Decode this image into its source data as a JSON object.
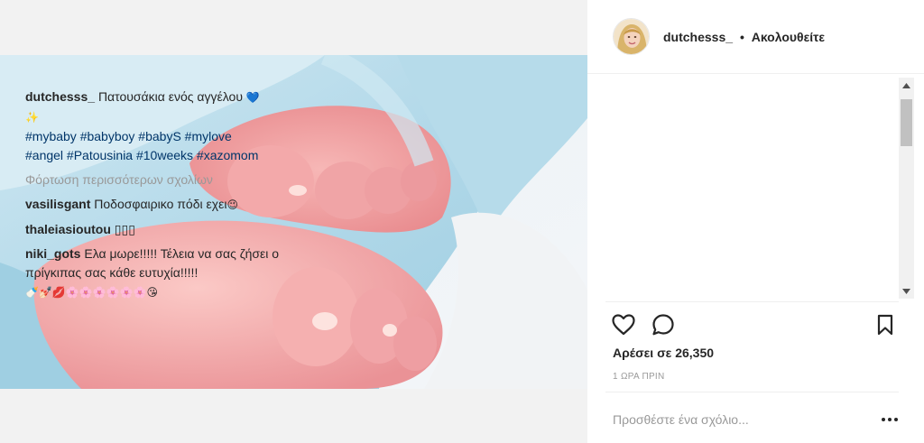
{
  "header": {
    "username": "dutchesss_",
    "separator": "•",
    "follow_status": "Ακολουθείτε"
  },
  "caption": {
    "username": "dutchesss_",
    "text": "Πατουσάκια ενός αγγέλου",
    "emoji_heart": "💙",
    "emoji_sparkles": "✨",
    "hashtags_line1": "#mybaby #babyboy #babyS #mylove",
    "hashtags_line2": "#angel #Patousinia #10weeks #xazomom"
  },
  "load_more": "Φόρτωση περισσότερων σχολίων",
  "comments": [
    {
      "username": "vasilisgant",
      "text": "Ποδοσφαιρικο πόδι εχει",
      "emoji": "😉"
    },
    {
      "username": "thaleiasioutou",
      "text": "▯▯▯"
    },
    {
      "username": "niki_gots",
      "text": "Ελα μωρε!!!!! Τέλεια να σας ζήσει ο πρίγκιπας σας κάθε ευτυχία!!!!!",
      "emoji": "🍼💅🏻💋🌸🌸🌸🌸🌸🌸😘"
    }
  ],
  "likes": "Αρέσει σε 26,350",
  "time": "1 ΩΡΑ ΠΡΙΝ",
  "comment_input": {
    "placeholder": "Προσθέστε ένα σχόλιο..."
  },
  "icons": {
    "like": "heart-icon",
    "comment": "comment-bubble-icon",
    "save": "bookmark-icon",
    "more": "more-options-icon"
  },
  "colors": {
    "link": "#003569",
    "muted": "#999999",
    "text": "#262626",
    "blanket": "#a9d4e6"
  }
}
